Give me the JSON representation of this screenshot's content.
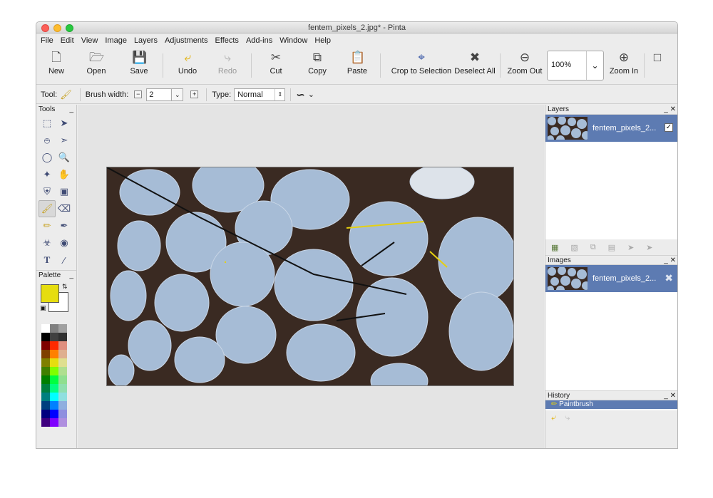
{
  "window": {
    "title": "fentem_pixels_2.jpg* - Pinta"
  },
  "menu": [
    "File",
    "Edit",
    "View",
    "Image",
    "Layers",
    "Adjustments",
    "Effects",
    "Add-ins",
    "Window",
    "Help"
  ],
  "toolbar": {
    "new": "New",
    "open": "Open",
    "save": "Save",
    "undo": "Undo",
    "redo": "Redo",
    "cut": "Cut",
    "copy": "Copy",
    "paste": "Paste",
    "crop": "Crop to Selection",
    "deselect": "Deselect All",
    "zoom_out": "Zoom Out",
    "zoom_value": "100%",
    "zoom_in": "Zoom In"
  },
  "options": {
    "tool_label": "Tool:",
    "brush_width_label": "Brush width:",
    "brush_width": "2",
    "type_label": "Type:",
    "type_value": "Normal"
  },
  "panes": {
    "tools": "Tools",
    "palette": "Palette",
    "layers": "Layers",
    "images": "Images",
    "history": "History"
  },
  "palette": {
    "primary": "#e6dd0f",
    "secondary": "#ffffff",
    "colors": [
      "#ffffff",
      "#808080",
      "#a0a0a0",
      "#000000",
      "#404040",
      "#303030",
      "#7f0000",
      "#ff2a00",
      "#df8f7f",
      "#7f3f00",
      "#ff8000",
      "#dfaf8f",
      "#7f7f00",
      "#e6dd0f",
      "#dfdf8f",
      "#3f7f00",
      "#80ff00",
      "#afdf8f",
      "#007f00",
      "#00ff40",
      "#8fdf8f",
      "#007f3f",
      "#00ff80",
      "#8fdfaf",
      "#007f7f",
      "#00ffff",
      "#8fdfdf",
      "#003f7f",
      "#0080ff",
      "#8fafdf",
      "#00007f",
      "#0000ff",
      "#8f8fdf",
      "#3f007f",
      "#8000ff",
      "#af8fdf"
    ]
  },
  "layers": {
    "item": "fentem_pixels_2..."
  },
  "images": {
    "item": "fentem_pixels_2..."
  },
  "history": {
    "item": "Paintbrush"
  }
}
